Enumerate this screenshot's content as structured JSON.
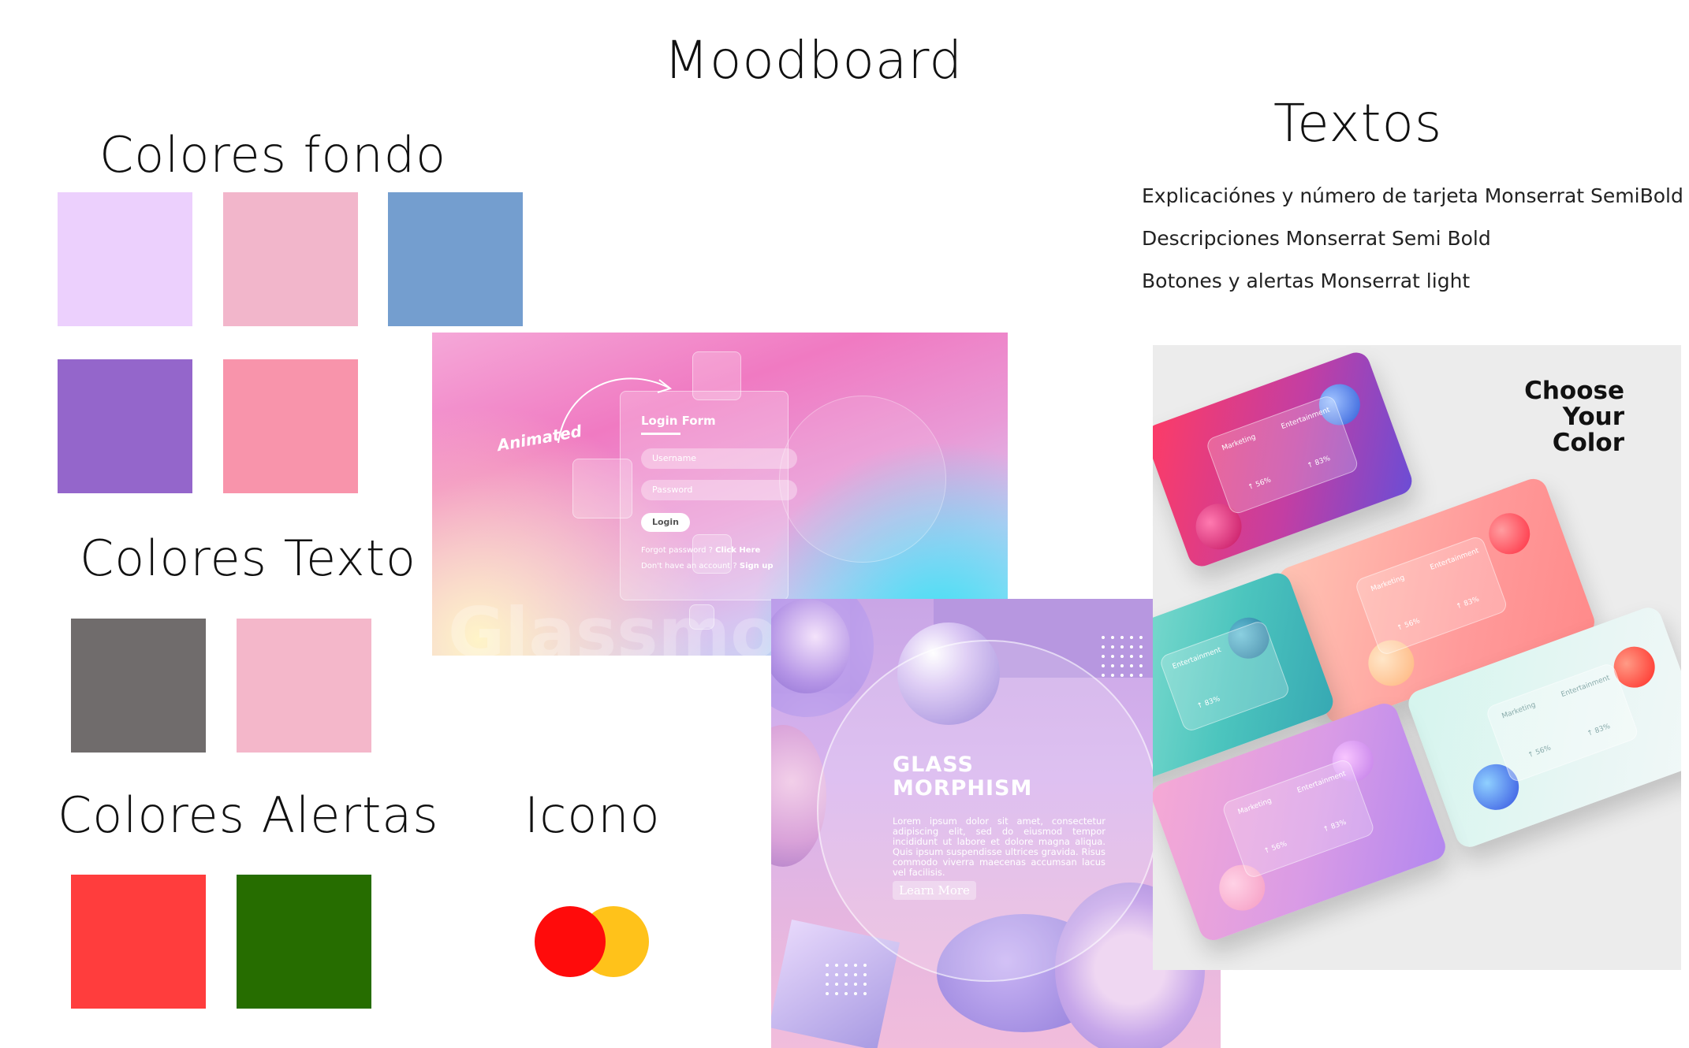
{
  "page": {
    "title": "Moodboard"
  },
  "colores_fondo": {
    "title": "Colores fondo",
    "swatches": [
      "#ecd0fd",
      "#f2b6cb",
      "#749ecf",
      "#9466cb",
      "#f894ab"
    ]
  },
  "colores_texto": {
    "title": "Colores Texto",
    "swatches": [
      "#706c6c",
      "#f4b7ca"
    ]
  },
  "colores_alertas": {
    "title": "Colores Alertas",
    "swatches": [
      "#ff3d3d",
      "#266d00"
    ]
  },
  "icono": {
    "title": "Icono",
    "icon": "mastercard-icon",
    "colors": [
      "#ff0b0b",
      "#ffc21a"
    ]
  },
  "textos": {
    "title": "Textos",
    "lines": [
      "Explicaciónes y número de tarjeta Monserrat SemiBold",
      "Descripciones Monserrat Semi Bold",
      "Botones y alertas Monserrat light"
    ]
  },
  "login_image": {
    "annotation": "Animated",
    "form_title": "Login Form",
    "username_placeholder": "Username",
    "password_placeholder": "Password",
    "login_button": "Login",
    "forgot_text": "Forgot password ?",
    "forgot_link": "Click Here",
    "signup_text": "Don't have an account ?",
    "signup_link": "Sign up",
    "watermark": "Glassmor"
  },
  "glass_image": {
    "title_line1": "GLASS",
    "title_line2": "MORPHISM",
    "body": "Lorem ipsum dolor sit amet, consectetur adipiscing elit, sed do eiusmod tempor incididunt ut labore et dolore magna aliqua. Quis ipsum suspendisse ultrices gravida. Risus commodo viverra maecenas accumsan lacus vel facilisis.",
    "button": "Learn More"
  },
  "cards_image": {
    "heading_line1": "Choose",
    "heading_line2": "Your",
    "heading_line3": "Color",
    "label_a": "Marketing",
    "label_b": "Entertainment",
    "value_a": "↑ 56%",
    "value_b": "↑ 83%"
  }
}
